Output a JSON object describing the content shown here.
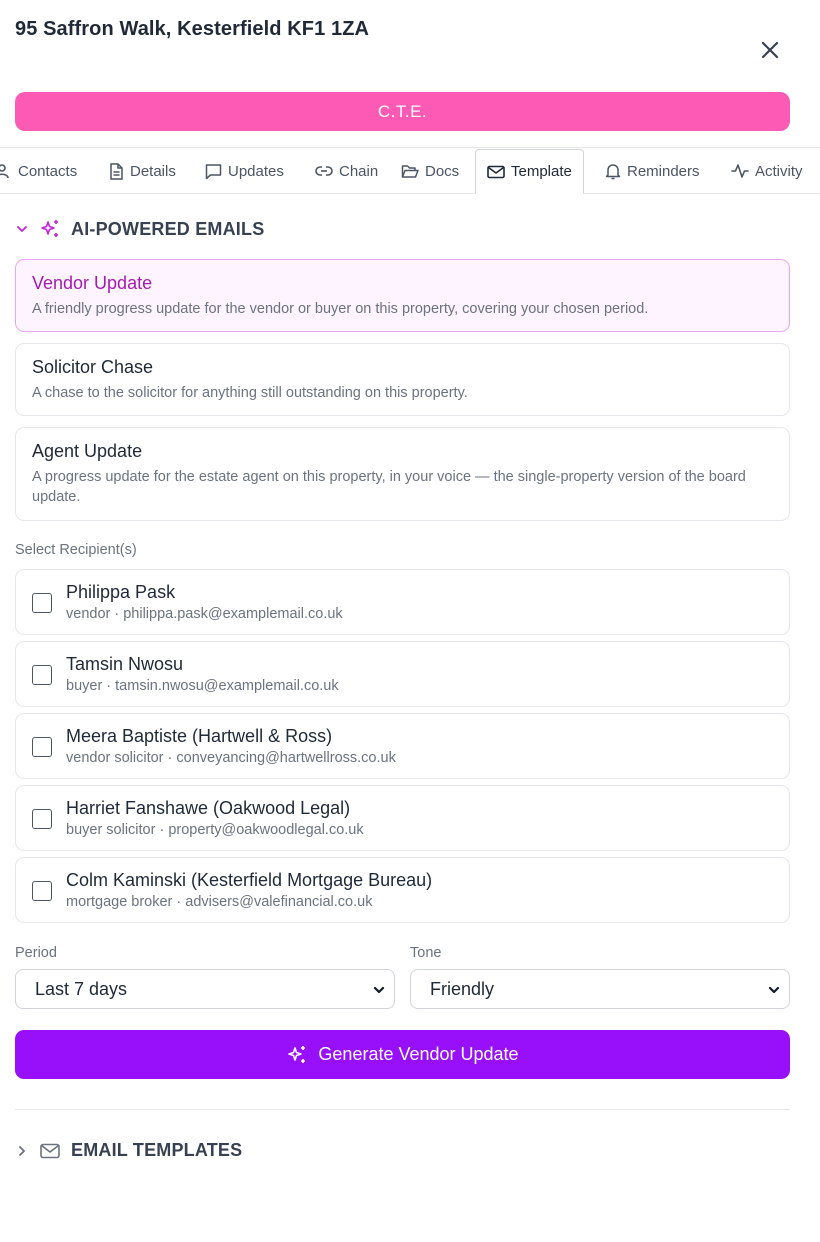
{
  "header": {
    "title": "95 Saffron Walk, Kesterfield KF1 1ZA"
  },
  "status": {
    "label": "C.T.E.",
    "color": "#fd5ab5"
  },
  "tabs": [
    {
      "label": "Contacts",
      "icon": "user-icon"
    },
    {
      "label": "Details",
      "icon": "file-text-icon"
    },
    {
      "label": "Updates",
      "icon": "message-square-icon"
    },
    {
      "label": "Chain",
      "icon": "link-icon"
    },
    {
      "label": "Docs",
      "icon": "folder-open-icon"
    },
    {
      "label": "Template",
      "icon": "mail-icon",
      "active": true
    },
    {
      "label": "Reminders",
      "icon": "bell-icon"
    },
    {
      "label": "Activity",
      "icon": "activity-icon"
    }
  ],
  "ai_section": {
    "label": "AI-POWERED EMAILS",
    "expanded": true,
    "templates": [
      {
        "title": "Vendor Update",
        "description": "A friendly progress update for the vendor or buyer on this property, covering your chosen period.",
        "selected": true
      },
      {
        "title": "Solicitor Chase",
        "description": "A chase to the solicitor for anything still outstanding on this property."
      },
      {
        "title": "Agent Update",
        "description": "A progress update for the estate agent on this property, in your voice — the single-property version of the board update."
      }
    ],
    "recipients_label": "Select Recipient(s)",
    "recipients": [
      {
        "name": "Philippa Pask",
        "sub": "vendor · philippa.pask@examplemail.co.uk"
      },
      {
        "name": "Tamsin Nwosu",
        "sub": "buyer · tamsin.nwosu@examplemail.co.uk"
      },
      {
        "name": "Meera Baptiste (Hartwell & Ross)",
        "sub": "vendor solicitor · conveyancing@hartwellross.co.uk"
      },
      {
        "name": "Harriet Fanshawe (Oakwood Legal)",
        "sub": "buyer solicitor · property@oakwoodlegal.co.uk"
      },
      {
        "name": "Colm Kaminski (Kesterfield Mortgage Bureau)",
        "sub": "mortgage broker · advisers@valefinancial.co.uk"
      }
    ],
    "period": {
      "label": "Period",
      "value": "Last 7 days"
    },
    "tone": {
      "label": "Tone",
      "value": "Friendly"
    },
    "generate_label": "Generate Vendor Update",
    "accent": "#9810fa"
  },
  "templates_section": {
    "label": "EMAIL TEMPLATES",
    "expanded": false
  }
}
